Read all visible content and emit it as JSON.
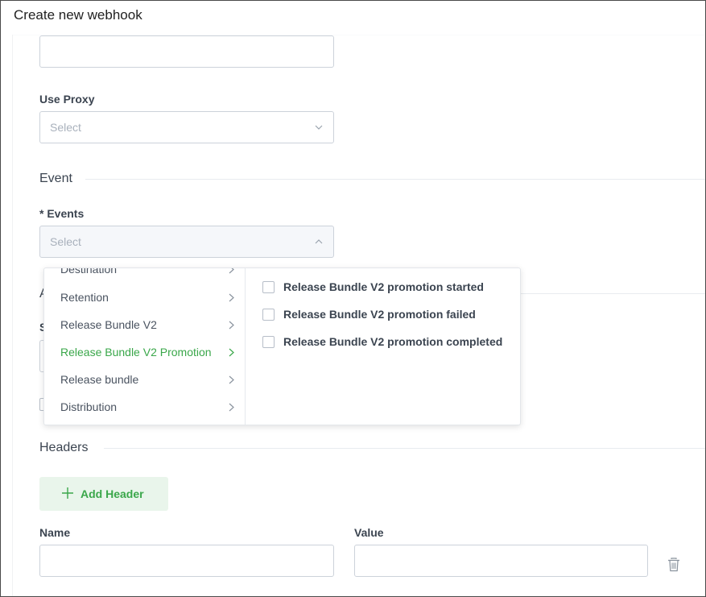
{
  "window": {
    "title": "Create new webhook"
  },
  "form": {
    "proxy": {
      "label": "Use Proxy",
      "placeholder": "Select"
    },
    "event_section": {
      "title": "Event"
    },
    "events": {
      "label": "* Events",
      "placeholder": "Select"
    },
    "headers_section": {
      "title": "Headers"
    },
    "add_header_label": "Add Header",
    "header_columns": {
      "name_label": "Name",
      "value_label": "Value"
    }
  },
  "behind_dropdown": {
    "section_fragment": "A",
    "label_fragment": "S"
  },
  "events_dropdown": {
    "categories": [
      {
        "label": "Destination",
        "active": false
      },
      {
        "label": "Retention",
        "active": false
      },
      {
        "label": "Release Bundle V2",
        "active": false
      },
      {
        "label": "Release Bundle V2 Promotion",
        "active": true
      },
      {
        "label": "Release bundle",
        "active": false
      },
      {
        "label": "Distribution",
        "active": false
      }
    ],
    "options": [
      {
        "label": "Release Bundle V2 promotion started",
        "checked": false
      },
      {
        "label": "Release Bundle V2 promotion failed",
        "checked": false
      },
      {
        "label": "Release Bundle V2 promotion completed",
        "checked": false
      }
    ]
  },
  "colors": {
    "accent_green": "#3aa74a",
    "add_header_bg": "#e9f5eb",
    "border": "#ccd2da",
    "text": "#3b4450"
  },
  "icons": {
    "select_closed": "chevron-down-icon",
    "select_open": "chevron-up-icon",
    "category_arrow": "chevron-right-icon",
    "add": "plus-icon",
    "delete": "trash-icon"
  }
}
